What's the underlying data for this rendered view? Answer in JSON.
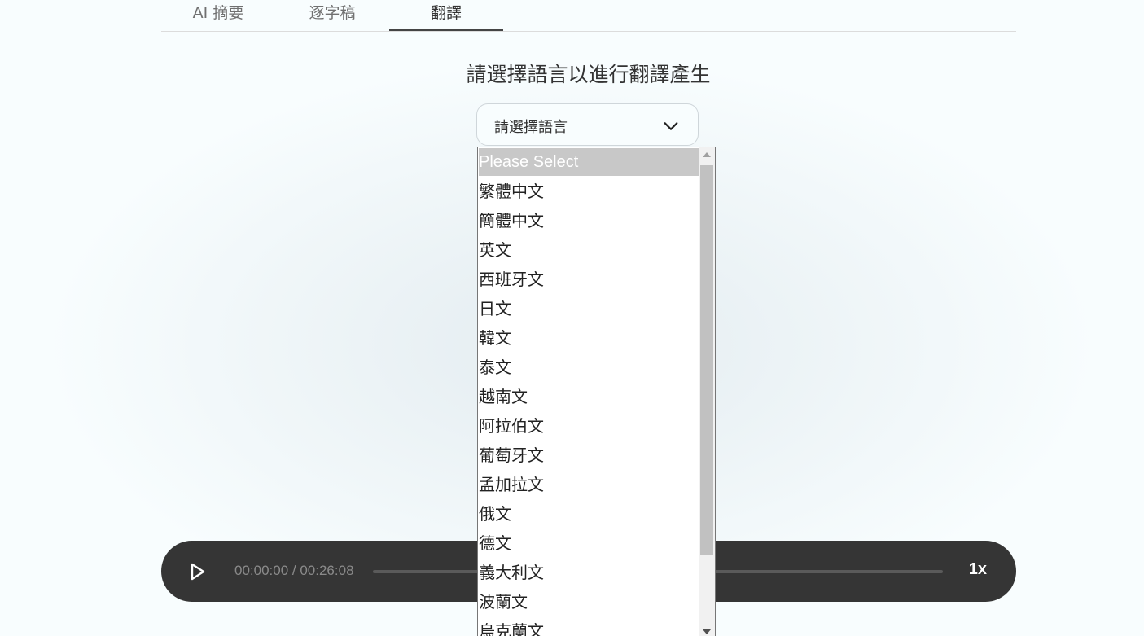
{
  "tabs": [
    {
      "label": "AI 摘要"
    },
    {
      "label": "逐字稿"
    },
    {
      "label": "翻譯"
    }
  ],
  "heading": "請選擇語言以進行翻譯產生",
  "language_select": {
    "value": "請選擇語言",
    "options": [
      "Please Select",
      "繁體中文",
      "簡體中文",
      "英文",
      "西班牙文",
      "日文",
      "韓文",
      "泰文",
      "越南文",
      "阿拉伯文",
      "葡萄牙文",
      "孟加拉文",
      "俄文",
      "德文",
      "義大利文",
      "波蘭文",
      "烏克蘭文"
    ]
  },
  "player": {
    "time": "00:00:00 / 00:26:08",
    "speed": "1x",
    "progress": 0
  },
  "icons": {
    "play": "play-icon",
    "chevron": "chevron-down-icon"
  }
}
